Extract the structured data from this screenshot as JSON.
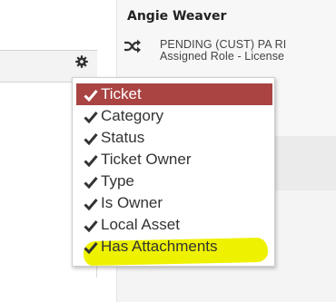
{
  "contact": {
    "name": "Angie Weaver",
    "status_line1": "PENDING (CUST) PA RI",
    "status_line2": "Assigned Role - License"
  },
  "icons": {
    "status": "shuffle-icon",
    "settings": "gear-icon",
    "check": "checkmark-icon"
  },
  "colors": {
    "selected_bg": "#a94442",
    "highlight": "#eef200"
  },
  "column_menu": {
    "items": [
      {
        "label": "Ticket",
        "checked": true,
        "selected": true
      },
      {
        "label": "Category",
        "checked": true,
        "selected": false
      },
      {
        "label": "Status",
        "checked": true,
        "selected": false
      },
      {
        "label": "Ticket Owner",
        "checked": true,
        "selected": false
      },
      {
        "label": "Type",
        "checked": true,
        "selected": false
      },
      {
        "label": "Is Owner",
        "checked": true,
        "selected": false
      },
      {
        "label": "Local Asset",
        "checked": true,
        "selected": false
      },
      {
        "label": "Has Attachments",
        "checked": true,
        "selected": false,
        "highlighted": true
      }
    ]
  }
}
